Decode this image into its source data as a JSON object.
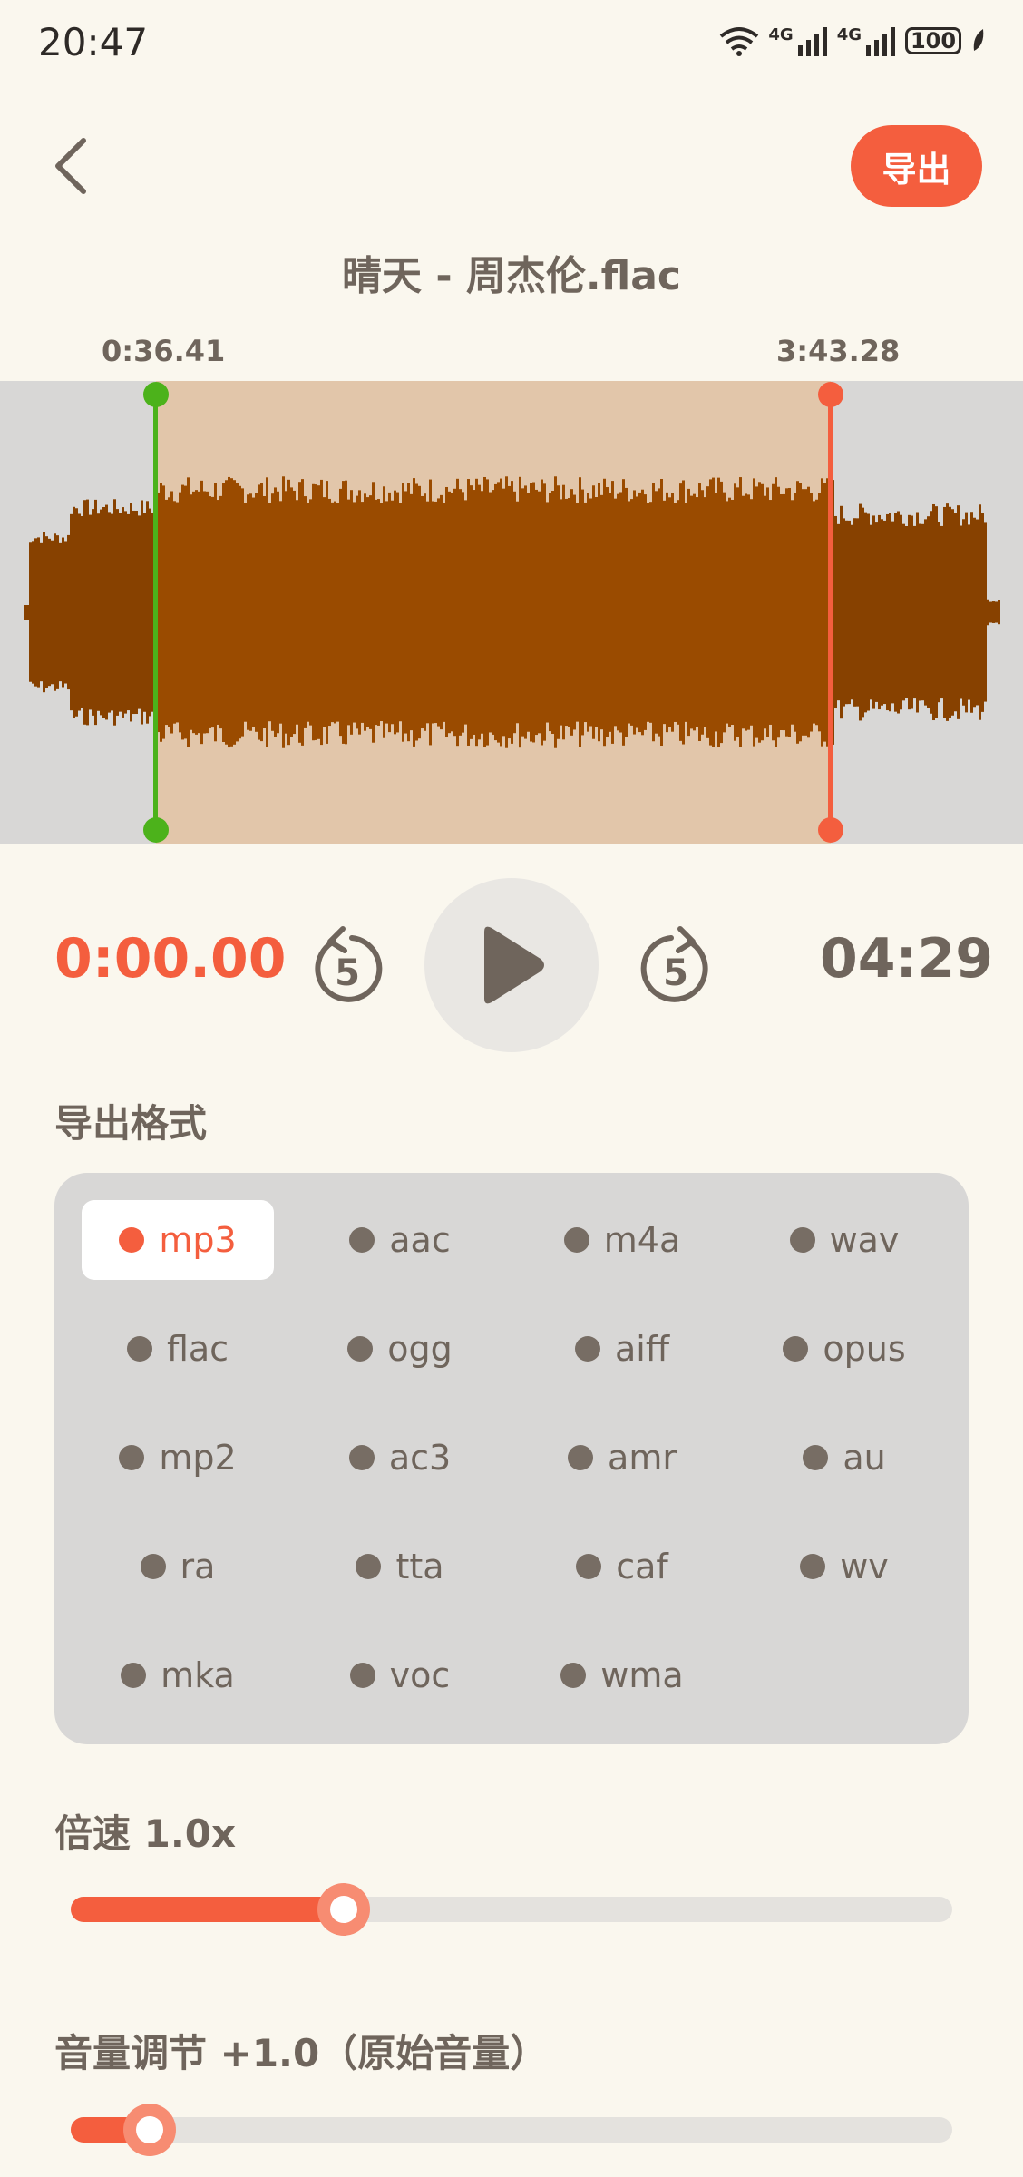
{
  "status_bar": {
    "time": "20:47",
    "signal1": "4G",
    "signal2": "4G",
    "battery": "100"
  },
  "header": {
    "export_label": "导出",
    "file_title": "晴天 - 周杰伦.flac"
  },
  "waveform": {
    "start_time": "0:36.41",
    "end_time": "3:43.28"
  },
  "playback": {
    "current_time": "0:00.00",
    "total_time": "04:29",
    "skip_seconds": "5"
  },
  "format": {
    "label": "导出格式",
    "selected": "mp3",
    "options": [
      "mp3",
      "aac",
      "m4a",
      "wav",
      "flac",
      "ogg",
      "aiff",
      "opus",
      "mp2",
      "ac3",
      "amr",
      "au",
      "ra",
      "tta",
      "caf",
      "wv",
      "mka",
      "voc",
      "wma"
    ]
  },
  "speed": {
    "label": "倍速 1.0x",
    "level_fraction": 0.31
  },
  "volume": {
    "label": "音量调节  +1.0（原始音量）",
    "level_fraction": 0.09
  },
  "colors": {
    "accent": "#F45E3E",
    "start_marker": "#4CB21B",
    "waveform": "#9A4B00",
    "background": "#FAF7EE"
  }
}
